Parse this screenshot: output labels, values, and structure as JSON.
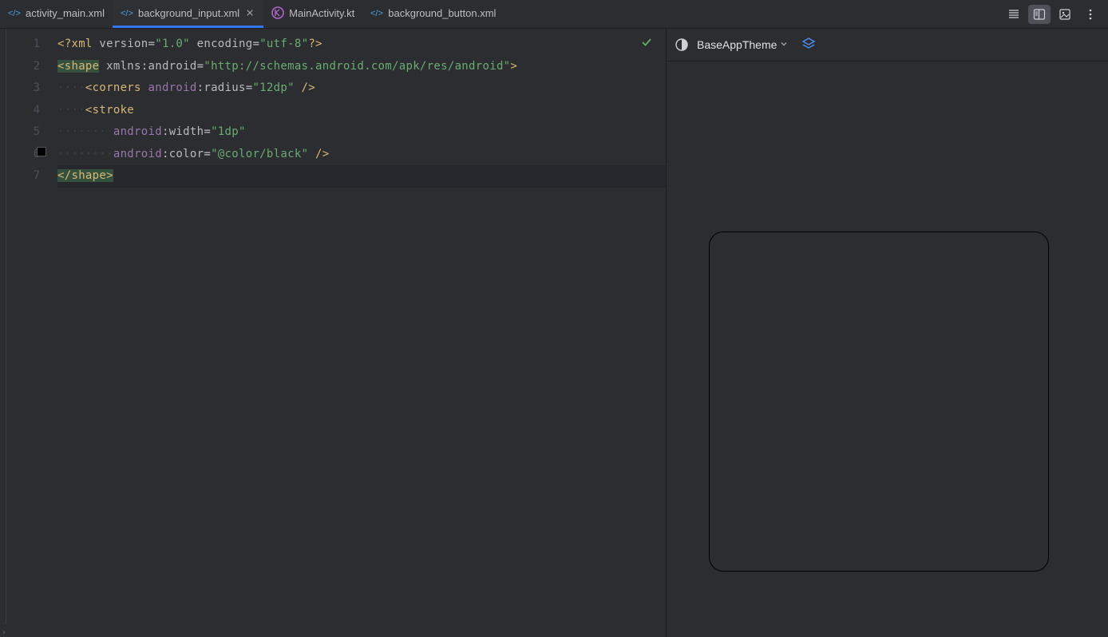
{
  "tabs": [
    {
      "label": "activity_main.xml",
      "icon": "xml",
      "active": false,
      "closeable": false
    },
    {
      "label": "background_input.xml",
      "icon": "xml",
      "active": true,
      "closeable": true
    },
    {
      "label": "MainActivity.kt",
      "icon": "kt",
      "active": false,
      "closeable": false
    },
    {
      "label": "background_button.xml",
      "icon": "xml",
      "active": false,
      "closeable": false
    }
  ],
  "gutter": {
    "lines": [
      "1",
      "2",
      "3",
      "4",
      "5",
      "6",
      "7"
    ],
    "colorSwatchLine": 6
  },
  "code": {
    "xmlDecl": {
      "open": "<?",
      "xml": "xml",
      "sp1": " ",
      "version": "version",
      "eq": "=",
      "versionVal": "\"1.0\"",
      "sp2": " ",
      "encoding": "encoding",
      "encodingVal": "\"utf-8\"",
      "close": "?>"
    },
    "shapeOpen": {
      "lt": "<",
      "name": "shape",
      "sp": " ",
      "xmlns": "xmlns:",
      "android": "android",
      "eq": "=",
      "url": "\"http://schemas.android.com/apk/res/android\"",
      "gt": ">"
    },
    "corners": {
      "dots": "····",
      "lt": "<",
      "name": "corners",
      "sp": " ",
      "ns": "android",
      "colon": ":",
      "attr": "radius",
      "eq": "=",
      "val": "\"12dp\"",
      "close": " />"
    },
    "strokeOpen": {
      "dots": "····",
      "lt": "<",
      "name": "stroke"
    },
    "strokeWidth": {
      "dots": "········",
      "ns": "android",
      "colon": ":",
      "attr": "width",
      "eq": "=",
      "val": "\"1dp\""
    },
    "strokeColor": {
      "dots": "········",
      "ns": "android",
      "colon": ":",
      "attr": "color",
      "eq": "=",
      "val": "\"@color/black\"",
      "close": " />"
    },
    "shapeClose": {
      "lt": "</",
      "name": "shape",
      "gt": ">"
    }
  },
  "preview": {
    "theme": "BaseAppTheme"
  }
}
